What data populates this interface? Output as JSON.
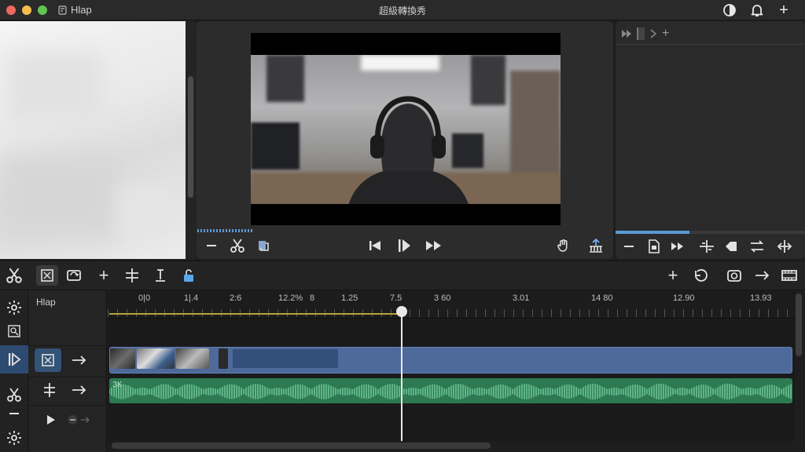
{
  "app": {
    "name": "Hlap",
    "window_title": "超級轉換秀"
  },
  "colors": {
    "accent": "#5a9bd5",
    "video_clip": "#4d6a9b",
    "audio_clip": "#2d7a52",
    "playhead": "#e8e8e8"
  },
  "titlebar": {
    "traffic_lights": [
      "close",
      "minimize",
      "zoom"
    ],
    "right_icons": [
      "appearance-icon",
      "notifications-icon",
      "add-icon"
    ],
    "plus": "+"
  },
  "viewer": {
    "controls_left": [
      "minus-icon",
      "scissors-icon",
      "clip-icon"
    ],
    "controls_center": [
      "previous-icon",
      "play-icon",
      "fast-forward-icon"
    ],
    "controls_right": [
      "hand-icon",
      "export-icon"
    ]
  },
  "inspector": {
    "top_plus": "+",
    "progress": 0.39,
    "buttons": [
      "minus-icon",
      "document-icon",
      "forward-icon",
      "align-icon",
      "tag-icon",
      "swap-icon",
      "split-icon"
    ]
  },
  "toolbar": {
    "left": [
      "scissors-icon",
      "crop-icon",
      "loop-icon",
      "add-icon",
      "split-icon",
      "marker-icon",
      "lock-icon"
    ],
    "right": [
      "add-icon",
      "undo-icon",
      "snapshot-icon",
      "forward-icon",
      "film-icon"
    ],
    "plus": "+"
  },
  "timeline": {
    "track_title": "Hlap",
    "ruler_labels": [
      "0|0",
      "1|.4",
      "2:6",
      "12.2%",
      "8",
      "1.25",
      "7.5",
      "3 60",
      "3.01",
      "14 80",
      "12.90",
      "13.93"
    ],
    "audio_label": "ЗК",
    "playhead_position": "7.5"
  }
}
